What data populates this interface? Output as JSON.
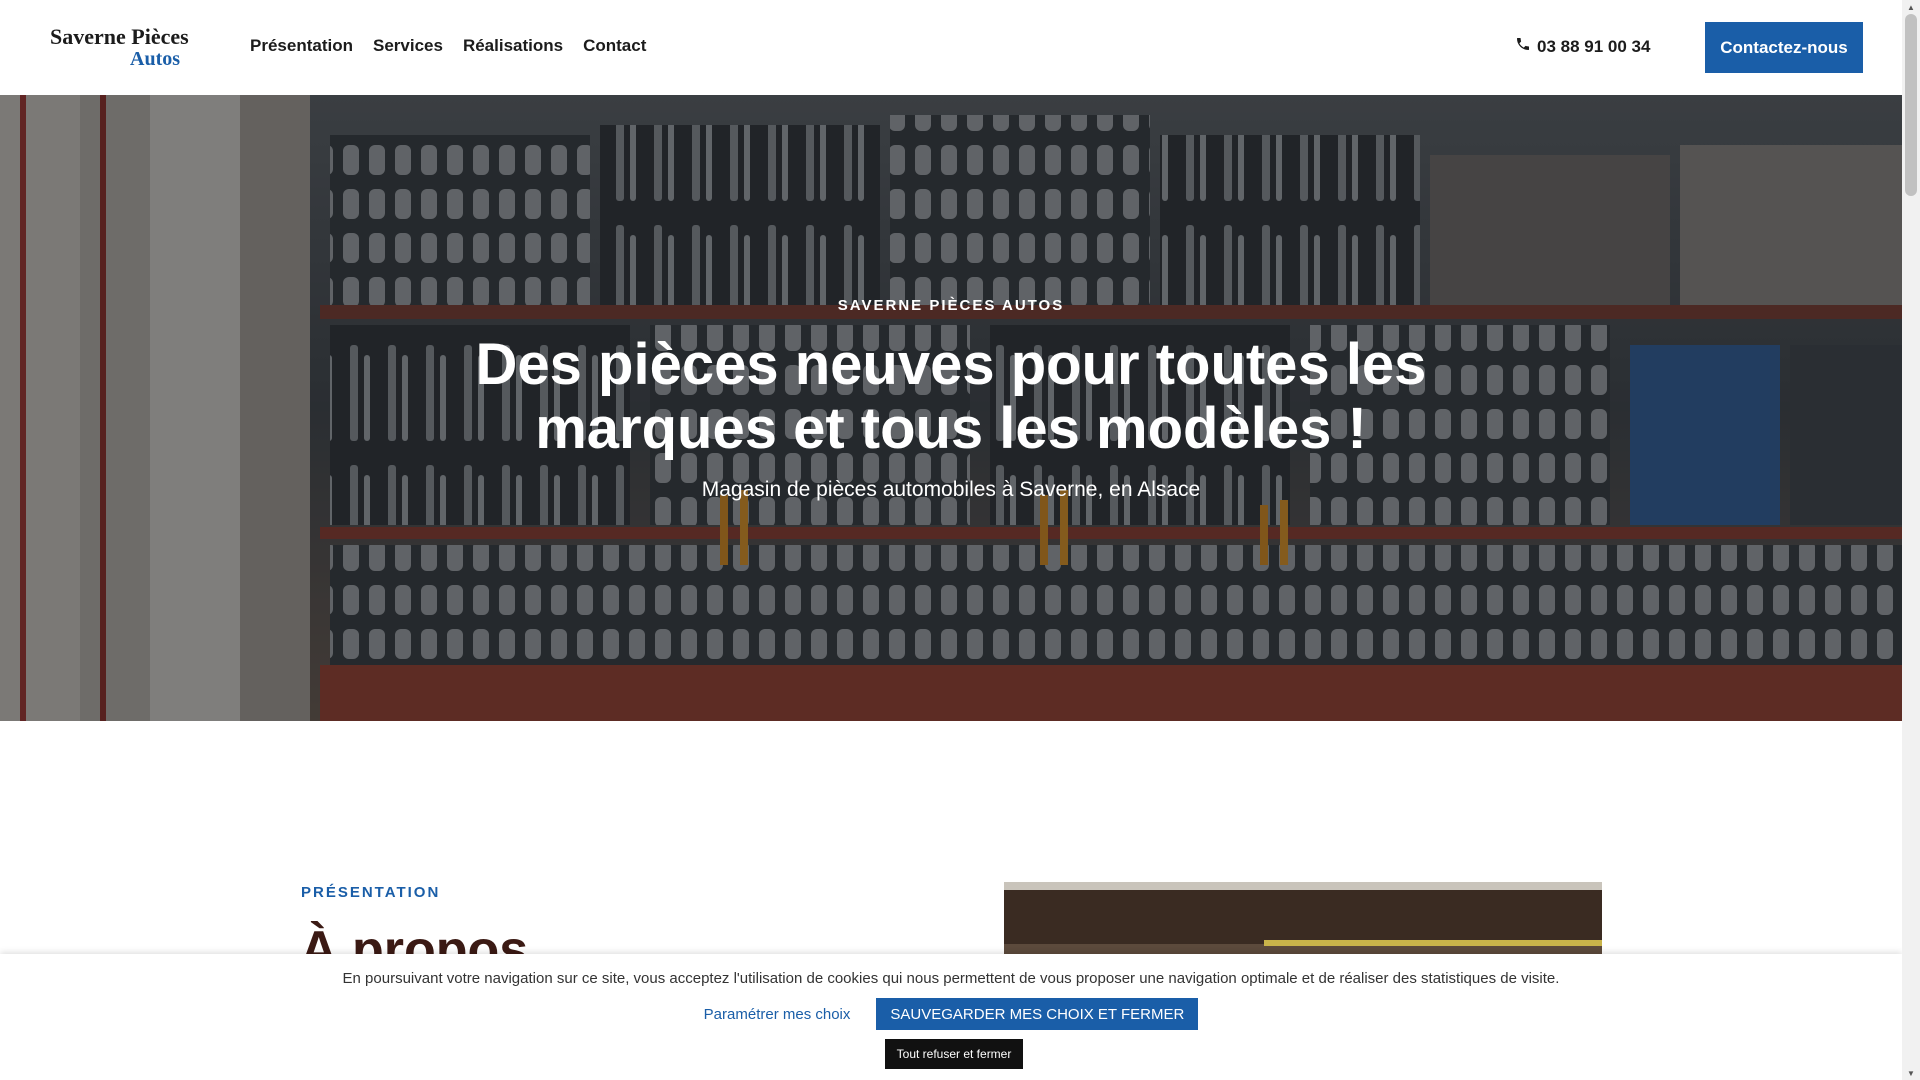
{
  "header": {
    "logo_line1": "Saverne Pièces",
    "logo_line2": "Autos",
    "nav": [
      "Présentation",
      "Services",
      "Réalisations",
      "Contact"
    ],
    "phone": "03 88 91 00 34",
    "cta_label": "Contactez-nous"
  },
  "hero": {
    "eyebrow": "SAVERNE PIÈCES AUTOS",
    "title": "Des pièces neuves pour toutes les marques et tous les modèles !",
    "subtitle": "Magasin de pièces automobiles à Saverne, en Alsace"
  },
  "presentation": {
    "eyebrow": "PRÉSENTATION",
    "title": "À propos"
  },
  "cookie": {
    "text": "En poursuivant votre navigation sur ce site, vous acceptez l'utilisation de cookies qui nous permettent de vous proposer une navigation optimale et de réaliser des statistiques de visite.",
    "settings_label": "Paramétrer mes choix",
    "save_label": "SAUVEGARDER MES CHOIX ET FERMER",
    "refuse_label": "Tout refuser et fermer"
  },
  "colors": {
    "brand": "#1a5ea8",
    "dark": "#1c1c1c"
  },
  "icons": {
    "phone": "phone-icon"
  }
}
